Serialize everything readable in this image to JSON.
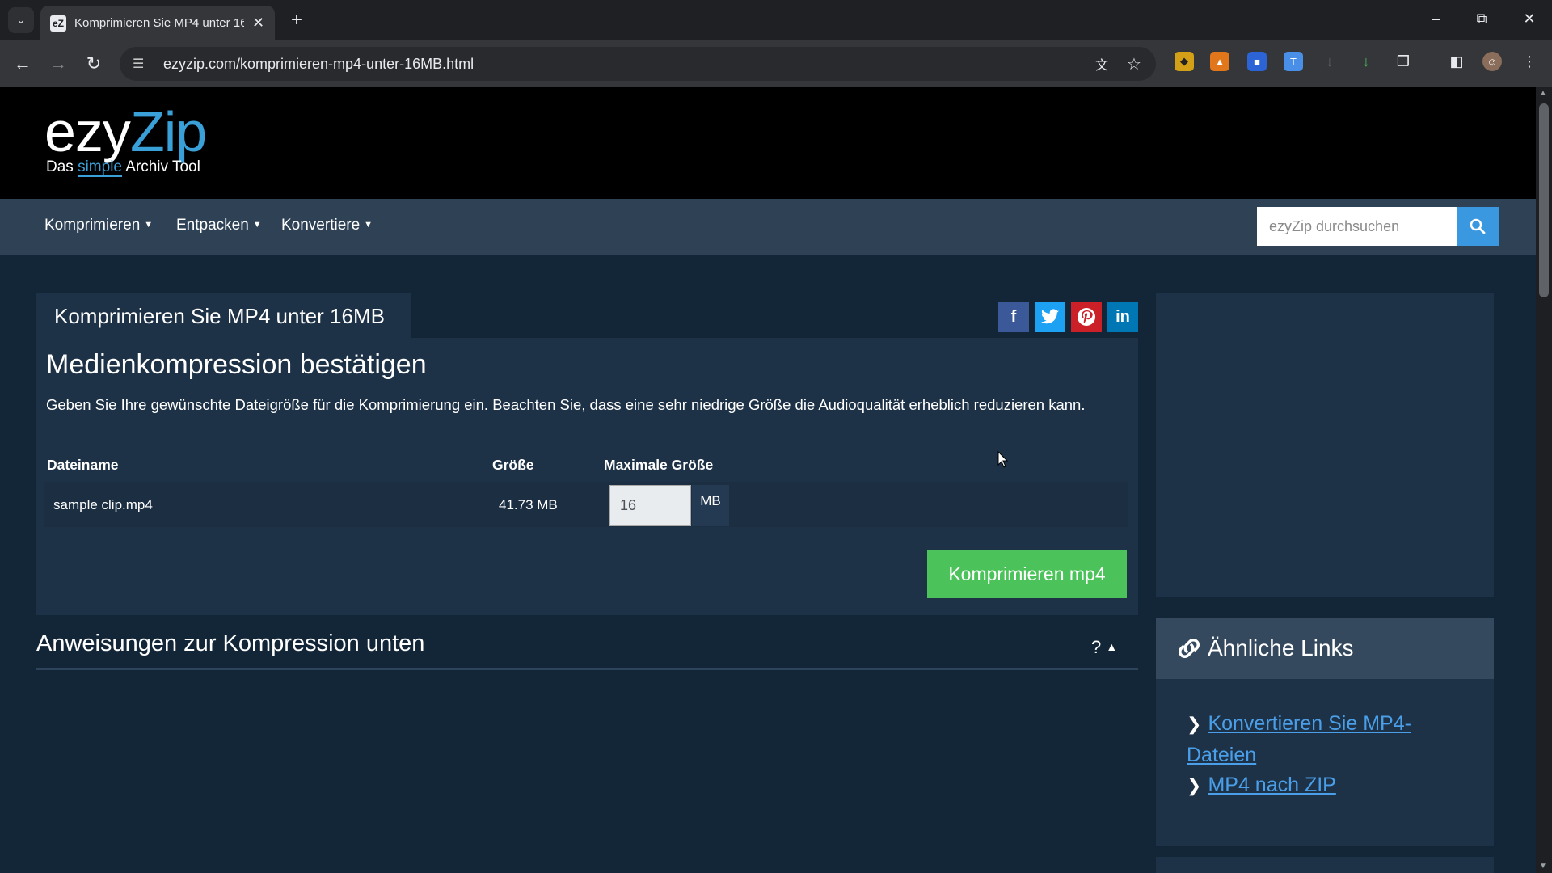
{
  "browser": {
    "tab_title": "Komprimieren Sie MP4 unter 16",
    "tab_favicon": "eZ",
    "url": "ezyzip.com/komprimieren-mp4-unter-16MB.html"
  },
  "site": {
    "logo_ezy": "ezy",
    "logo_zip": "Zip",
    "tagline_pre": "Das ",
    "tagline_simple": "simple",
    "tagline_post": " Archiv Tool"
  },
  "nav": {
    "items": [
      "Komprimieren",
      "Entpacken",
      "Konvertiere"
    ],
    "search_placeholder": "ezyZip durchsuchen"
  },
  "main": {
    "tab_title": "Komprimieren Sie MP4 unter 16MB",
    "heading": "Medienkompression bestätigen",
    "description": "Geben Sie Ihre gewünschte Dateigröße für die Komprimierung ein. Beachten Sie, dass eine sehr niedrige Größe die Audioqualität erheblich reduzieren kann.",
    "table": {
      "headers": [
        "Dateiname",
        "Größe",
        "Maximale Größe"
      ],
      "row": {
        "filename": "sample clip.mp4",
        "size": "41.73 MB",
        "max_size": "16",
        "unit": "MB"
      }
    },
    "compress_button": "Komprimieren mp4",
    "instructions_heading": "Anweisungen zur Kompression unten",
    "instructions_toggle": "?"
  },
  "sidebar": {
    "links_heading": "Ähnliche Links",
    "links": [
      "Konvertieren Sie MP4-Dateien",
      "MP4 nach ZIP"
    ]
  },
  "social": {
    "facebook_color": "#3b5998",
    "twitter_color": "#1da1f2",
    "pinterest_color": "#cb2027",
    "linkedin_color": "#0077b5"
  }
}
